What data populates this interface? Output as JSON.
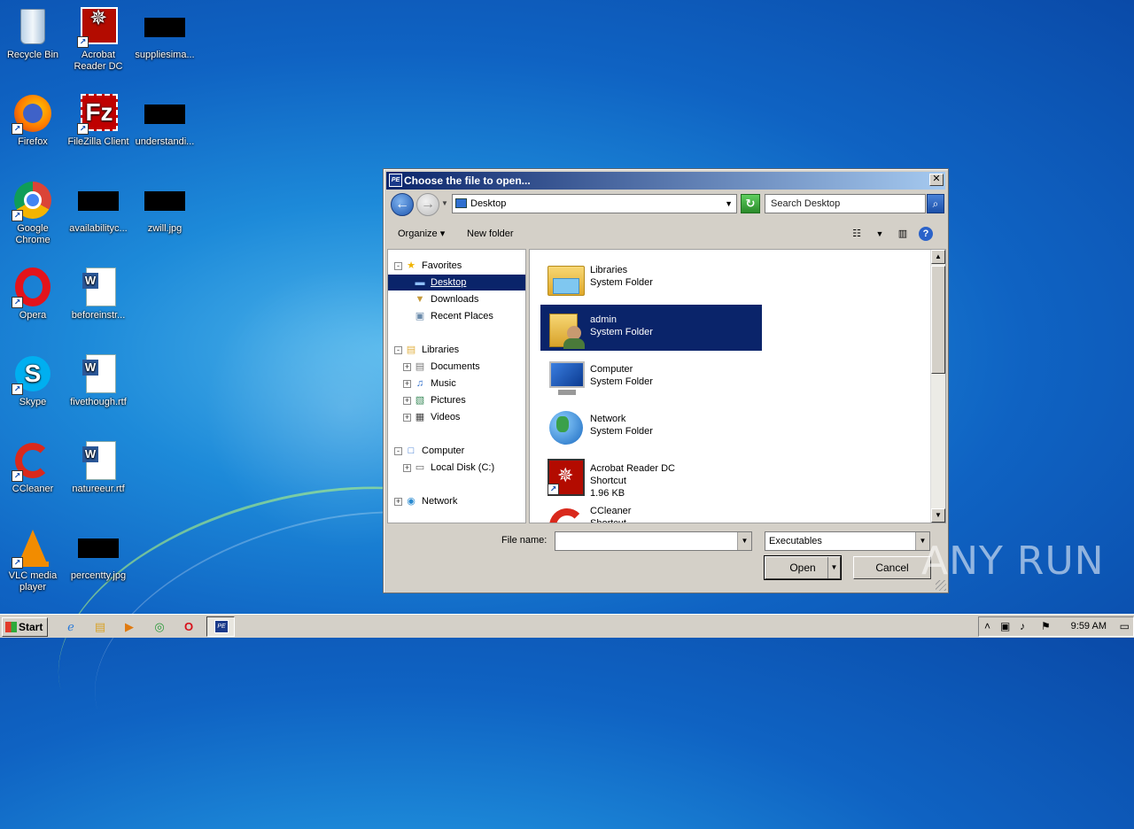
{
  "desktop": {
    "icons": [
      {
        "label": "Recycle Bin"
      },
      {
        "label": "Acrobat Reader DC"
      },
      {
        "label": "suppliesima..."
      },
      {
        "label": "Firefox"
      },
      {
        "label": "FileZilla Client"
      },
      {
        "label": "understandi..."
      },
      {
        "label": "Google Chrome"
      },
      {
        "label": "availabilityc..."
      },
      {
        "label": "zwill.jpg"
      },
      {
        "label": "Opera"
      },
      {
        "label": "beforeinstr..."
      },
      {
        "label": "Skype"
      },
      {
        "label": "fivethough.rtf"
      },
      {
        "label": "CCleaner"
      },
      {
        "label": "natureeur.rtf"
      },
      {
        "label": "VLC media player"
      },
      {
        "label": "percentty.jpg"
      }
    ]
  },
  "dialog": {
    "title": "Choose the file to open...",
    "address": "Desktop",
    "search_placeholder": "Search Desktop",
    "toolbar": {
      "organize": "Organize",
      "new_folder": "New folder"
    },
    "nav_tree": {
      "favorites": "Favorites",
      "desktop": "Desktop",
      "downloads": "Downloads",
      "recent_places": "Recent Places",
      "libraries": "Libraries",
      "documents": "Documents",
      "music": "Music",
      "pictures": "Pictures",
      "videos": "Videos",
      "computer": "Computer",
      "local_disk": "Local Disk (C:)",
      "network": "Network"
    },
    "files": [
      {
        "name": "Libraries",
        "type": "System Folder",
        "size": ""
      },
      {
        "name": "admin",
        "type": "System Folder",
        "size": ""
      },
      {
        "name": "Computer",
        "type": "System Folder",
        "size": ""
      },
      {
        "name": "Network",
        "type": "System Folder",
        "size": ""
      },
      {
        "name": "Acrobat Reader DC",
        "type": "Shortcut",
        "size": "1.96 KB"
      },
      {
        "name": "CCleaner",
        "type": "Shortcut",
        "size": ""
      }
    ],
    "file_name_label": "File name:",
    "file_name_value": "",
    "file_type": "Executables",
    "open_button": "Open",
    "cancel_button": "Cancel"
  },
  "taskbar": {
    "start_label": "Start",
    "clock": "9:59 AM"
  },
  "watermark": "ANY RUN"
}
